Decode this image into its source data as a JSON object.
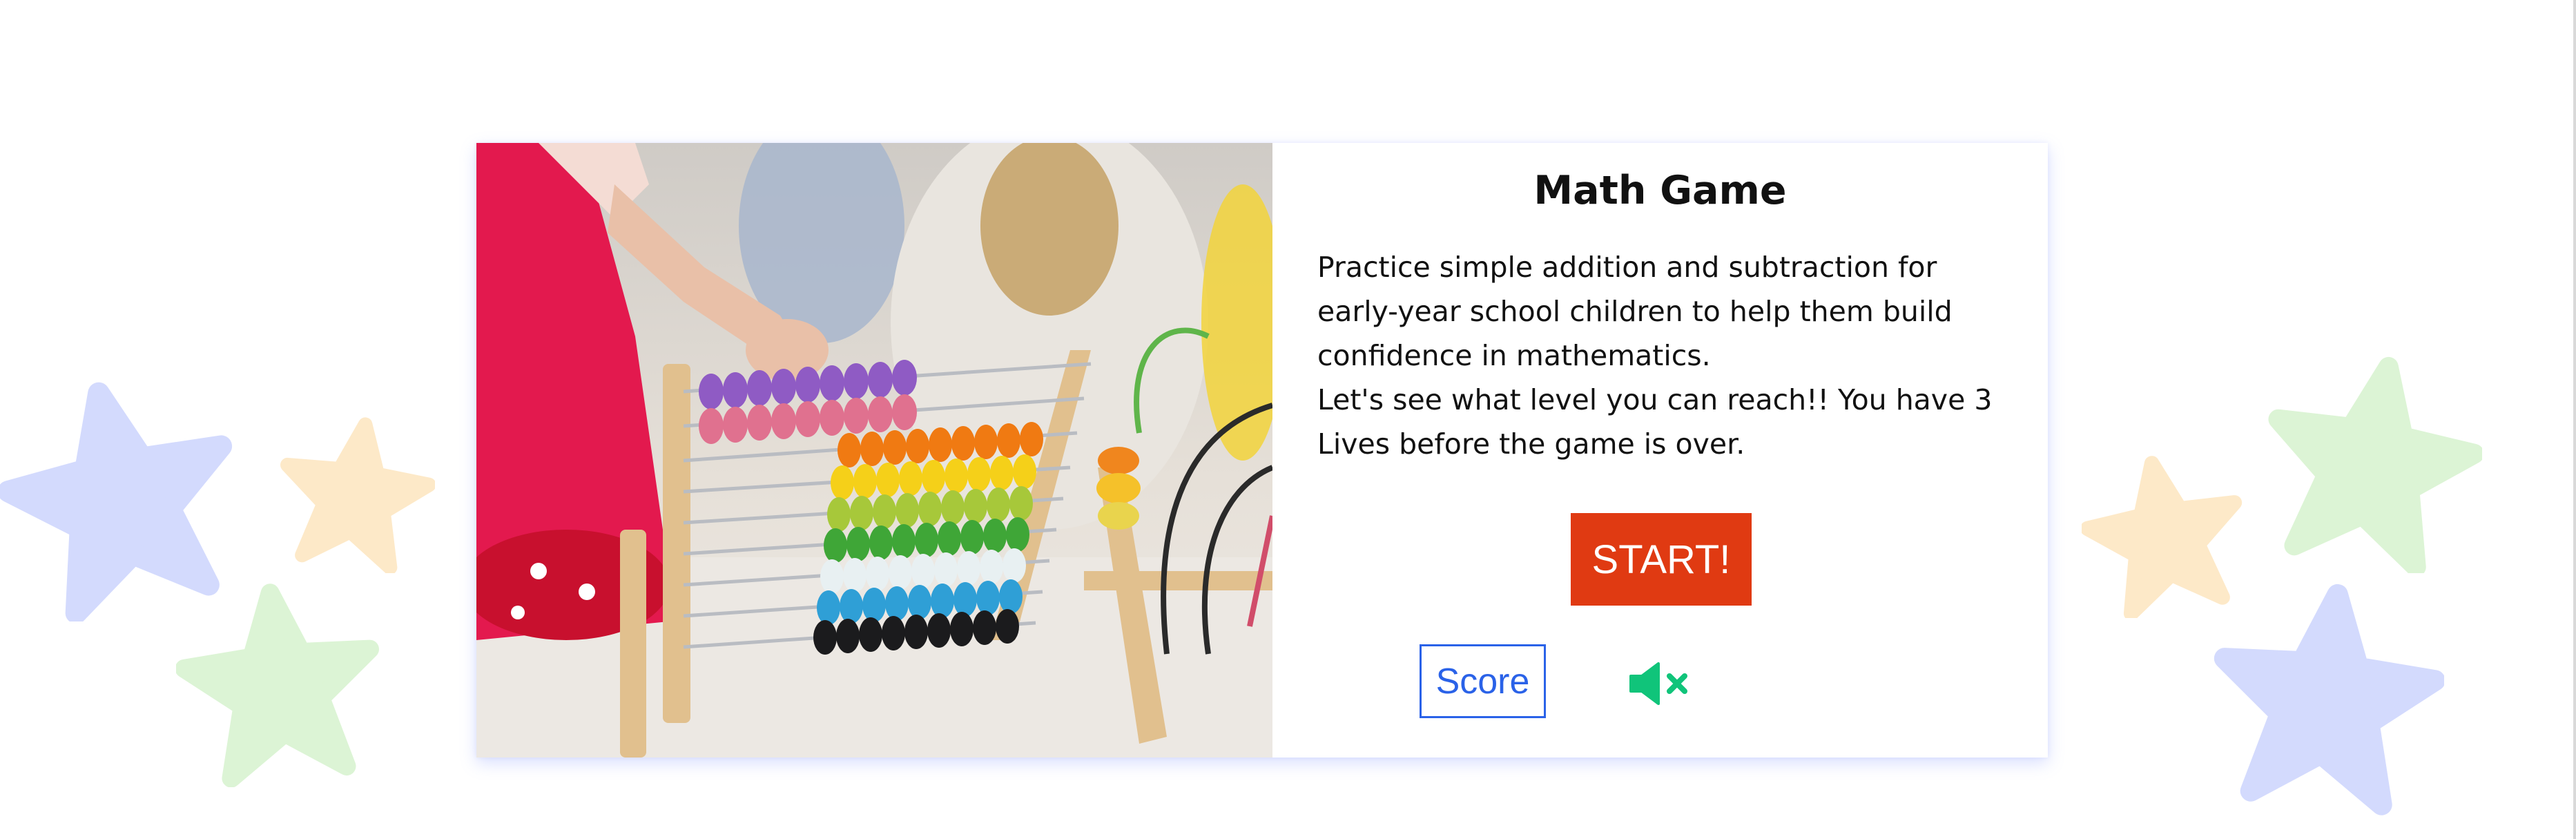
{
  "game": {
    "title": "Math Game",
    "description_line_1": "Practice simple addition and subtraction for early-year school children to help them build confidence in mathematics.",
    "description_line_2": "Let's see what level you can reach!! You have 3 Lives before the game is over.",
    "start_label": "START!",
    "score_label": "Score",
    "sound_state": "muted"
  },
  "icons": {
    "sound": "speaker-muted-icon",
    "decorations": [
      "star-icon"
    ]
  },
  "colors": {
    "start_button": "#e03a12",
    "score_button": "#2a62e8",
    "mute_icon": "#10c47a",
    "star_blue": "#d3dafd",
    "star_yellow": "#fde9c8",
    "star_green": "#dcf4d5"
  }
}
